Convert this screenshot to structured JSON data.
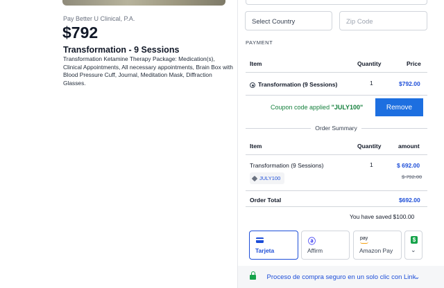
{
  "product": {
    "seller": "Pay Better U Clinical, P.A.",
    "price": "$792",
    "title": "Transformation - 9 Sessions",
    "description": "Transformation Ketamine Therapy Package: Medication(s), Clinical Appointments, All necessary appointments, Brain Box with Blood Pressure Cuff, Journal, Meditation Mask, Diffraction Glasses."
  },
  "address": {
    "country_placeholder": "Select Country",
    "zip_placeholder": "Zip Code"
  },
  "payment": {
    "section_label": "PAYMENT",
    "headers": {
      "item": "Item",
      "quantity": "Quantity",
      "price": "Price"
    },
    "selected_item": {
      "name": "Transformation (9 Sessions)",
      "quantity": "1",
      "price": "$792.00"
    },
    "coupon_message_prefix": "Coupon code applied ",
    "coupon_code": "\"JULY100\"",
    "remove_label": "Remove"
  },
  "summary": {
    "title": "Order Summary",
    "headers": {
      "item": "Item",
      "quantity": "Quantity",
      "amount": "amount"
    },
    "line": {
      "name": "Transformation (9 Sessions)",
      "quantity": "1",
      "amount": "$ 692.00",
      "original": "$ 792.00"
    },
    "coupon_tag": "JULY100",
    "total_label": "Order Total",
    "total_value": "$692.00",
    "saved": "You have saved $100.00"
  },
  "methods": [
    {
      "label": "Tarjeta",
      "icon": "credit-card-icon",
      "selected": true
    },
    {
      "label": "Affirm",
      "icon": "affirm-logo-icon",
      "selected": false
    },
    {
      "label": "Amazon Pay",
      "icon": "amazon-pay-icon",
      "selected": false
    },
    {
      "label": "",
      "icon": "cash-app-icon",
      "selected": false
    }
  ],
  "secure_checkout": {
    "text": "Proceso de compra seguro en un solo clic con Link"
  },
  "colors": {
    "accent": "#1d4ed8",
    "success": "#15803d",
    "button": "#1d6fe0"
  }
}
